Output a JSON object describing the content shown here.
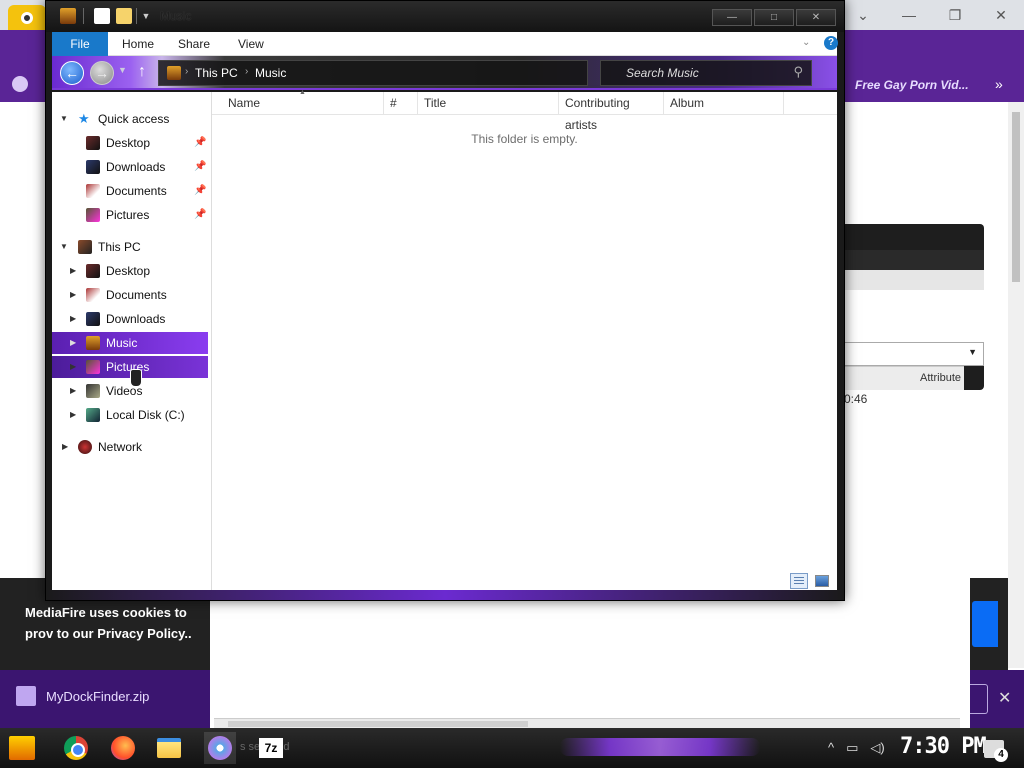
{
  "explorer": {
    "title": "Music",
    "ribbon_tabs": [
      "File",
      "Home",
      "Share",
      "View"
    ],
    "breadcrumb": [
      "This PC",
      "Music"
    ],
    "search_placeholder": "Search Music",
    "columns": [
      "Name",
      "#",
      "Title",
      "Contributing artists",
      "Album"
    ],
    "empty_message": "This folder is empty.",
    "nav": {
      "quick_access": "Quick access",
      "quick_items": [
        "Desktop",
        "Downloads",
        "Documents",
        "Pictures"
      ],
      "this_pc": "This PC",
      "pc_items": [
        "Desktop",
        "Documents",
        "Downloads",
        "Music",
        "Pictures",
        "Videos",
        "Local Disk (C:)"
      ],
      "network": "Network",
      "selected": "Music"
    }
  },
  "browser": {
    "bookmark_last": "Free Gay Porn Vid...",
    "cookie_text": "MediaFire uses cookies to prov to our Privacy Policy..",
    "download_file": "MyDockFinder.zip"
  },
  "background_window": {
    "column_header": "Attribute",
    "time_fragment": "0:46",
    "status_fragment": "s selected"
  },
  "taskbar": {
    "clock": "7:30 PM",
    "notification_count": "4",
    "sevenzip_label": "7z"
  }
}
